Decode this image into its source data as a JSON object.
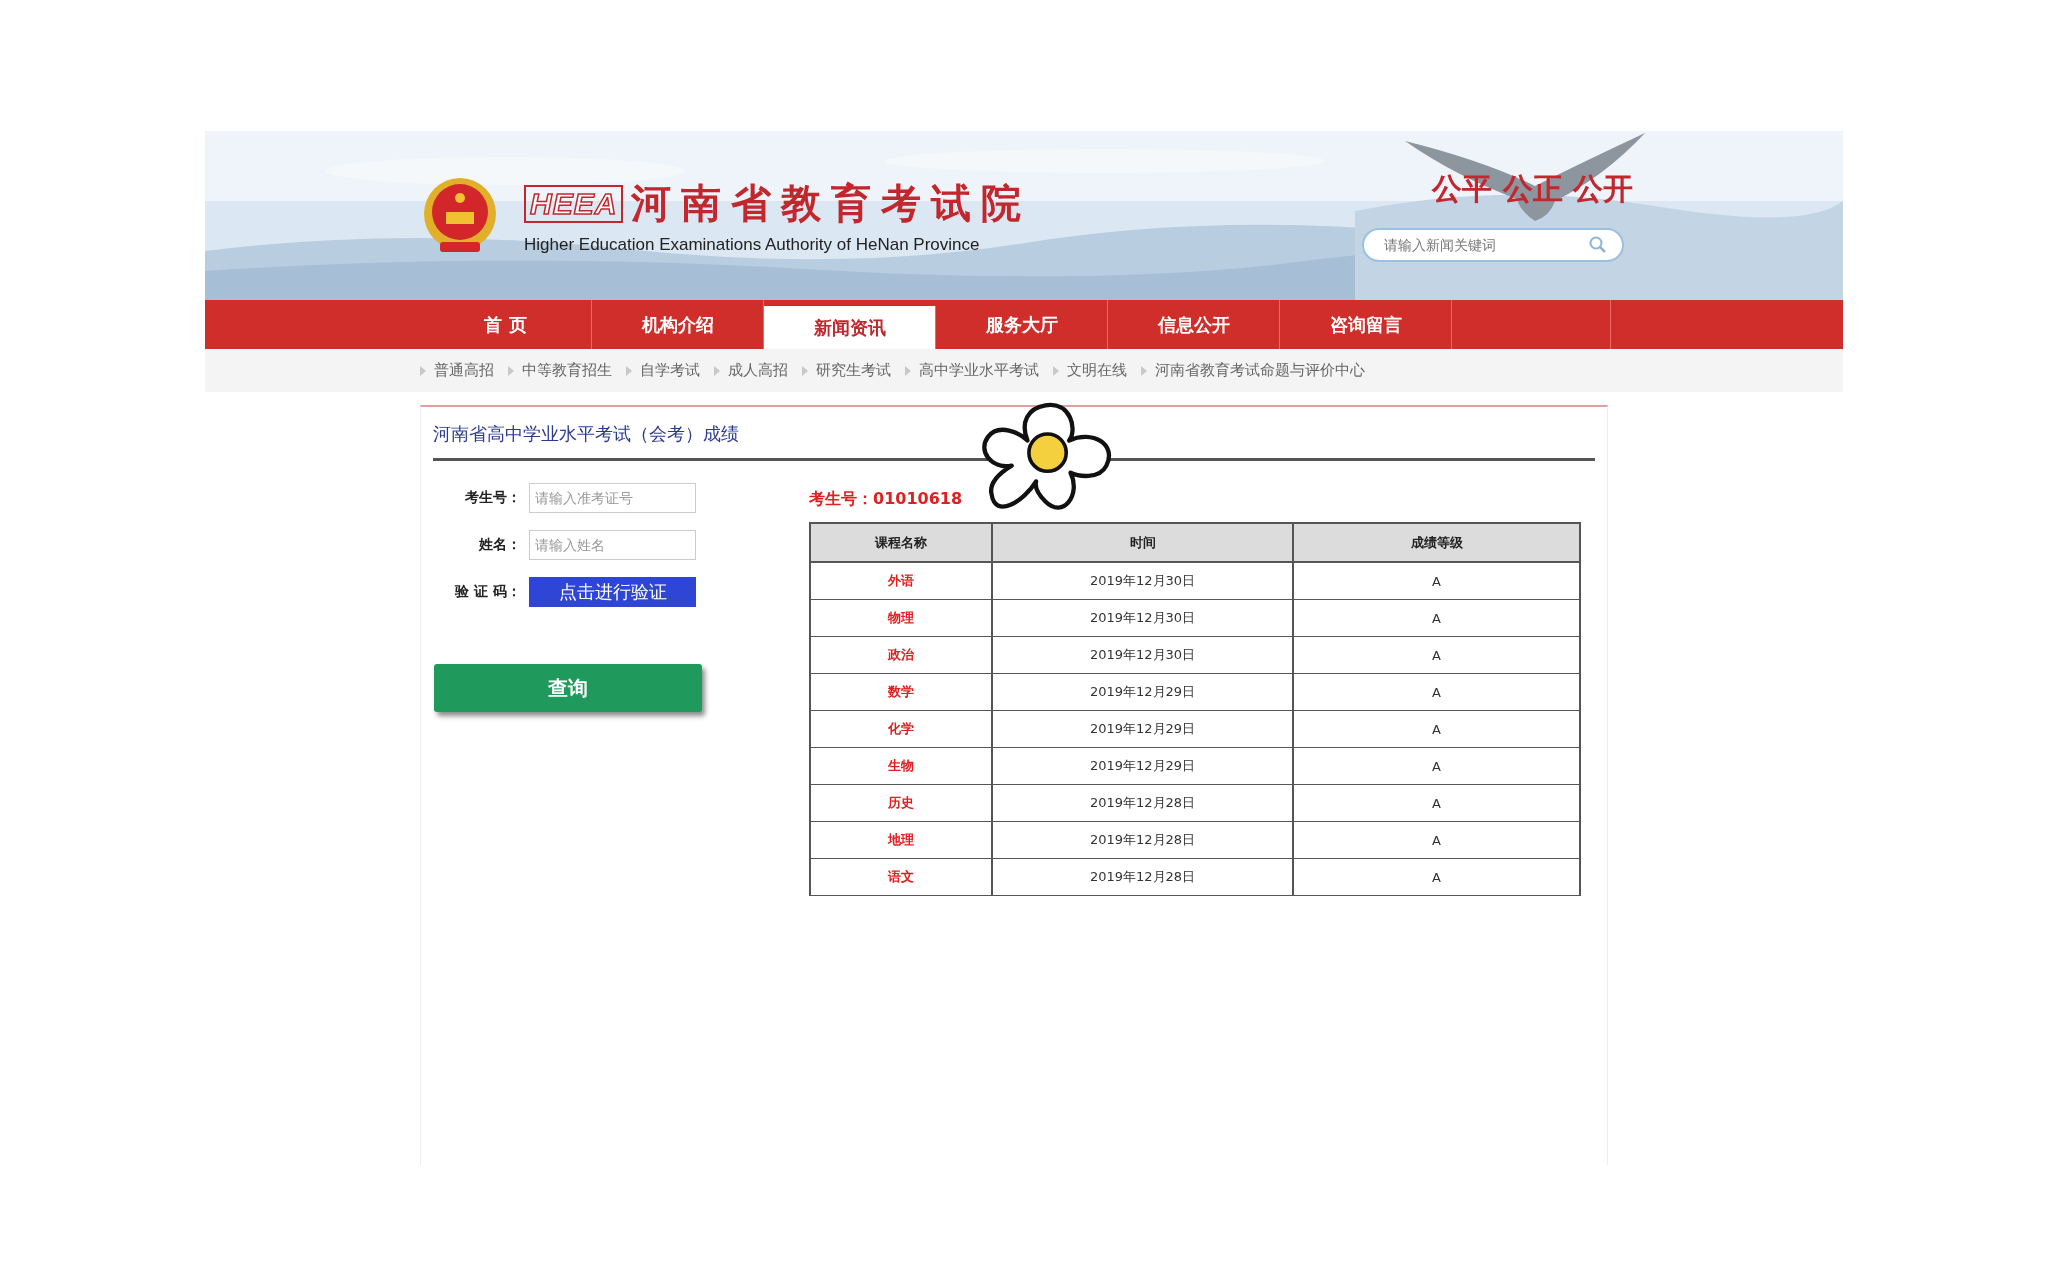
{
  "header": {
    "logo_mark": "HEEA",
    "title": "河南省教育考试院",
    "subtitle": "Higher Education Examinations Authority of HeNan Province",
    "slogan": "公平 公正 公开",
    "search": {
      "placeholder": "请输入新闻关键词"
    }
  },
  "nav": [
    {
      "label": "首 页",
      "selected": false
    },
    {
      "label": "机构介绍",
      "selected": false
    },
    {
      "label": "新闻资讯",
      "selected": true
    },
    {
      "label": "服务大厅",
      "selected": false
    },
    {
      "label": "信息公开",
      "selected": false
    },
    {
      "label": "咨询留言",
      "selected": false
    }
  ],
  "subnav": [
    "普通高招",
    "中等教育招生",
    "自学考试",
    "成人高招",
    "研究生考试",
    "高中学业水平考试",
    "文明在线",
    "河南省教育考试命题与评价中心"
  ],
  "page_title": "河南省高中学业水平考试（会考）成绩",
  "form": {
    "fields": [
      {
        "label": "考生号：",
        "placeholder": "请输入准考证号"
      },
      {
        "label": "姓名：",
        "placeholder": "请输入姓名"
      }
    ],
    "captcha": {
      "label": "验 证 码：",
      "button": "点击进行验证"
    },
    "submit": "查询"
  },
  "result": {
    "student_id": "考生号：01010618",
    "table": {
      "columns": [
        "课程名称",
        "时间",
        "成绩等级"
      ],
      "rows": [
        [
          "外语",
          "2019年12月30日",
          "A"
        ],
        [
          "物理",
          "2019年12月30日",
          "A"
        ],
        [
          "政治",
          "2019年12月30日",
          "A"
        ],
        [
          "数学",
          "2019年12月29日",
          "A"
        ],
        [
          "化学",
          "2019年12月29日",
          "A"
        ],
        [
          "生物",
          "2019年12月29日",
          "A"
        ],
        [
          "历史",
          "2019年12月28日",
          "A"
        ],
        [
          "地理",
          "2019年12月28日",
          "A"
        ],
        [
          "语文",
          "2019年12月28日",
          "A"
        ]
      ]
    }
  }
}
